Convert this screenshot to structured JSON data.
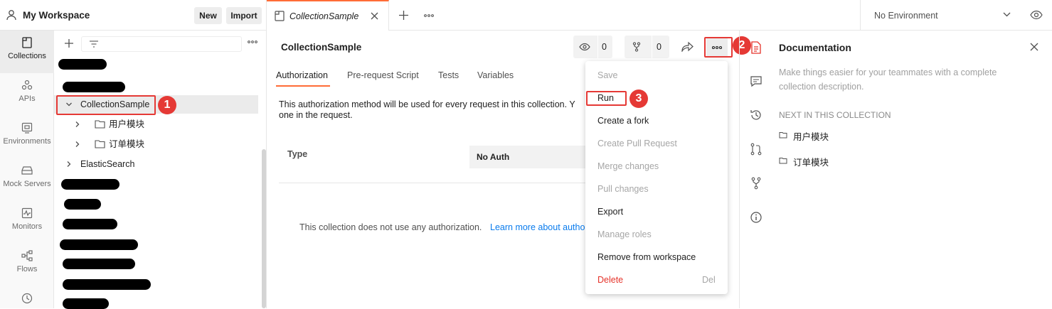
{
  "workspace": {
    "title": "My Workspace",
    "new_label": "New",
    "import_label": "Import"
  },
  "rail": [
    {
      "label": "Collections",
      "icon": "collections-icon"
    },
    {
      "label": "APIs",
      "icon": "apis-icon"
    },
    {
      "label": "Environments",
      "icon": "environments-icon"
    },
    {
      "label": "Mock Servers",
      "icon": "mock-servers-icon"
    },
    {
      "label": "Monitors",
      "icon": "monitors-icon"
    },
    {
      "label": "Flows",
      "icon": "flows-icon"
    },
    {
      "label": "",
      "icon": "history-icon"
    }
  ],
  "tree": {
    "items": [
      {
        "label": "CollectionSample",
        "expanded": true
      },
      {
        "label": "用户模块"
      },
      {
        "label": "订单模块"
      },
      {
        "label": "ElasticSearch"
      }
    ]
  },
  "tabs": {
    "active_label": "CollectionSample"
  },
  "environment": {
    "selected": "No Environment"
  },
  "main": {
    "title": "CollectionSample",
    "watch_count": "0",
    "fork_count": "0",
    "subtabs": [
      "Authorization",
      "Pre-request Script",
      "Tests",
      "Variables"
    ],
    "auth_desc_line1": "This authorization method will be used for every request in this collection. Y",
    "auth_desc_line2": "one in the request.",
    "type_label": "Type",
    "type_value": "No Auth",
    "no_auth_text": "This collection does not use any authorization.",
    "learn_more": "Learn more about autho"
  },
  "menu": {
    "items": [
      {
        "label": "Save",
        "state": "disabled"
      },
      {
        "label": "Run",
        "state": "normal"
      },
      {
        "label": "Create a fork",
        "state": "normal"
      },
      {
        "label": "Create Pull Request",
        "state": "disabled"
      },
      {
        "label": "Merge changes",
        "state": "disabled"
      },
      {
        "label": "Pull changes",
        "state": "disabled"
      },
      {
        "label": "Export",
        "state": "normal"
      },
      {
        "label": "Manage roles",
        "state": "disabled"
      },
      {
        "label": "Remove from workspace",
        "state": "normal"
      },
      {
        "label": "Delete",
        "state": "danger",
        "shortcut": "Del"
      }
    ]
  },
  "badges": [
    "1",
    "2",
    "3"
  ],
  "documentation": {
    "title": "Documentation",
    "desc_line1": "Make things easier for your teammates with a complete",
    "desc_line2": "collection description.",
    "next_header": "NEXT IN THIS COLLECTION",
    "next_items": [
      "用户模块",
      "订单模块"
    ]
  },
  "colors": {
    "accent": "#ff6c37",
    "annotation_red": "#e53935",
    "link": "#097bed",
    "danger": "#e5332a"
  }
}
